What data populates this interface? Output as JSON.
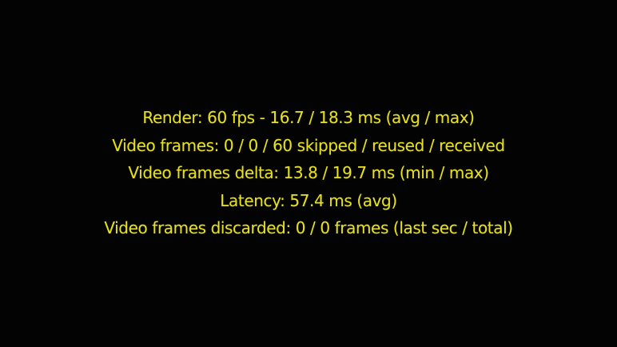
{
  "overlay": {
    "text_color": "#e6e020",
    "background_color": "#030303",
    "lines": [
      "Render: 60 fps - 16.7 / 18.3 ms (avg / max)",
      "Video frames: 0 / 0 / 60 skipped / reused / received",
      "Video frames delta: 13.8 / 19.7 ms (min / max)",
      "Latency: 57.4 ms (avg)",
      "Video frames discarded: 0 / 0 frames (last sec / total)"
    ]
  }
}
